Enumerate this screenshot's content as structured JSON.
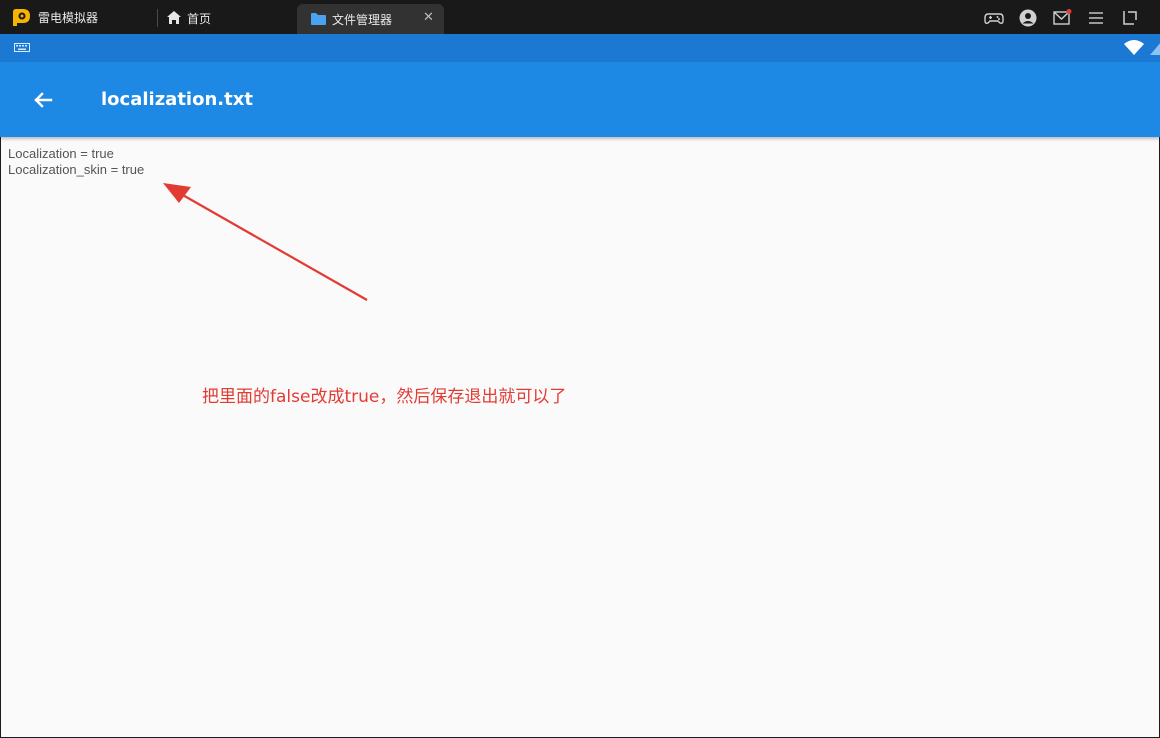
{
  "emulator": {
    "app_name": "雷电模拟器",
    "tabs": [
      {
        "label": "首页",
        "icon": "home-icon"
      },
      {
        "label": "文件管理器",
        "icon": "folder-icon",
        "active": true
      }
    ],
    "close_label": "✕",
    "toolbar_icons": [
      "gamepad-icon",
      "account-icon",
      "mail-icon",
      "menu-icon",
      "crop-icon"
    ]
  },
  "statusbar": {
    "icons": [
      "keyboard-icon",
      "wifi-icon",
      "signal-icon"
    ]
  },
  "appbar": {
    "title": "localization.txt",
    "back_icon": "arrow-back-icon"
  },
  "file": {
    "lines": [
      "Localization = true",
      "Localization_skin = true"
    ]
  },
  "annotation": {
    "text": "把里面的false改成true，然后保存退出就可以了",
    "color": "#e23b33"
  },
  "colors": {
    "statusbar": "#1b79d3",
    "appbar": "#1e88e5",
    "titlebar": "#191919",
    "content_bg": "#fafafa",
    "logo": "#f4b400"
  }
}
